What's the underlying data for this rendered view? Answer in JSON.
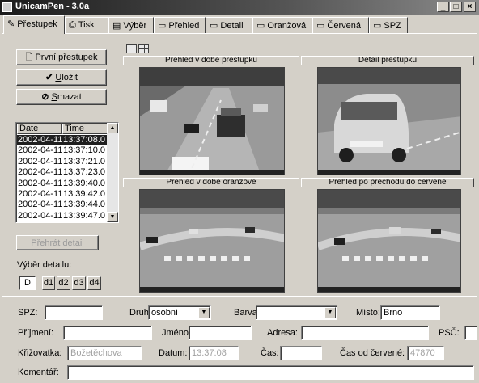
{
  "window": {
    "title": "UnicamPen - 3.0a",
    "controls": [
      "_",
      "□",
      "×"
    ]
  },
  "tabs": [
    {
      "label": "Přestupek",
      "icon": "pen-icon",
      "active": true
    },
    {
      "label": "Tisk",
      "icon": "printer-icon"
    },
    {
      "label": "Výběr",
      "icon": "filter-icon"
    },
    {
      "label": "Přehled",
      "icon": "camera-icon"
    },
    {
      "label": "Detail",
      "icon": "camera-icon"
    },
    {
      "label": "Oranžová",
      "icon": "camera-icon"
    },
    {
      "label": "Červená",
      "icon": "camera-icon"
    },
    {
      "label": "SPZ",
      "icon": "camera-icon"
    }
  ],
  "actions": {
    "first_prefix": "P",
    "first_rest": "rvní přestupek",
    "save_prefix": "U",
    "save_rest": "ložit",
    "delete_prefix": "S",
    "delete_rest": "mazat",
    "recalc": "Přehrát detail"
  },
  "list": {
    "headers": {
      "date": "Date",
      "time": "Time"
    },
    "rows": [
      {
        "date": "2002-04-11",
        "time": "13:37:08.0",
        "selected": true
      },
      {
        "date": "2002-04-11",
        "time": "13:37:10.0"
      },
      {
        "date": "2002-04-11",
        "time": "13:37:21.0"
      },
      {
        "date": "2002-04-11",
        "time": "13:37:23.0"
      },
      {
        "date": "2002-04-11",
        "time": "13:39:40.0"
      },
      {
        "date": "2002-04-11",
        "time": "13:39:42.0"
      },
      {
        "date": "2002-04-11",
        "time": "13:39:44.0"
      },
      {
        "date": "2002-04-11",
        "time": "13:39:47.0"
      }
    ]
  },
  "detail_select": {
    "label": "Výběr detailu:",
    "buttons": [
      "D",
      "d1",
      "d2",
      "d3",
      "d4"
    ]
  },
  "views": {
    "top_left": "Přehled v době přestupku",
    "top_right": "Detail přestupku",
    "bottom_left": "Přehled v době oranžové",
    "bottom_right": "Přehled po přechodu do červené"
  },
  "form": {
    "spz_label": "SPZ:",
    "spz_value": "",
    "druh_label": "Druh:",
    "druh_value": "osobní",
    "barva_label": "Barva:",
    "barva_value": "",
    "misto_label": "Místo:",
    "misto_value": "Brno",
    "prijmeni_label": "Příjmení:",
    "prijmeni_value": "",
    "jmeno_label": "Jméno:",
    "jmeno_value": "",
    "adresa_label": "Adresa:",
    "adresa_value": "",
    "psc_label": "PSČ:",
    "psc_value": "",
    "krizovatka_label": "Křižovatka:",
    "krizovatka_value": "Božetěchova",
    "datum_label": "Datum:",
    "datum_value": "13:37:08",
    "cas_label": "Čas:",
    "cas_value": "",
    "cas_cervene_label": "Čas od červené:",
    "cas_cervene_value": "47870",
    "komentar_label": "Komentář:",
    "komentar_value": ""
  }
}
